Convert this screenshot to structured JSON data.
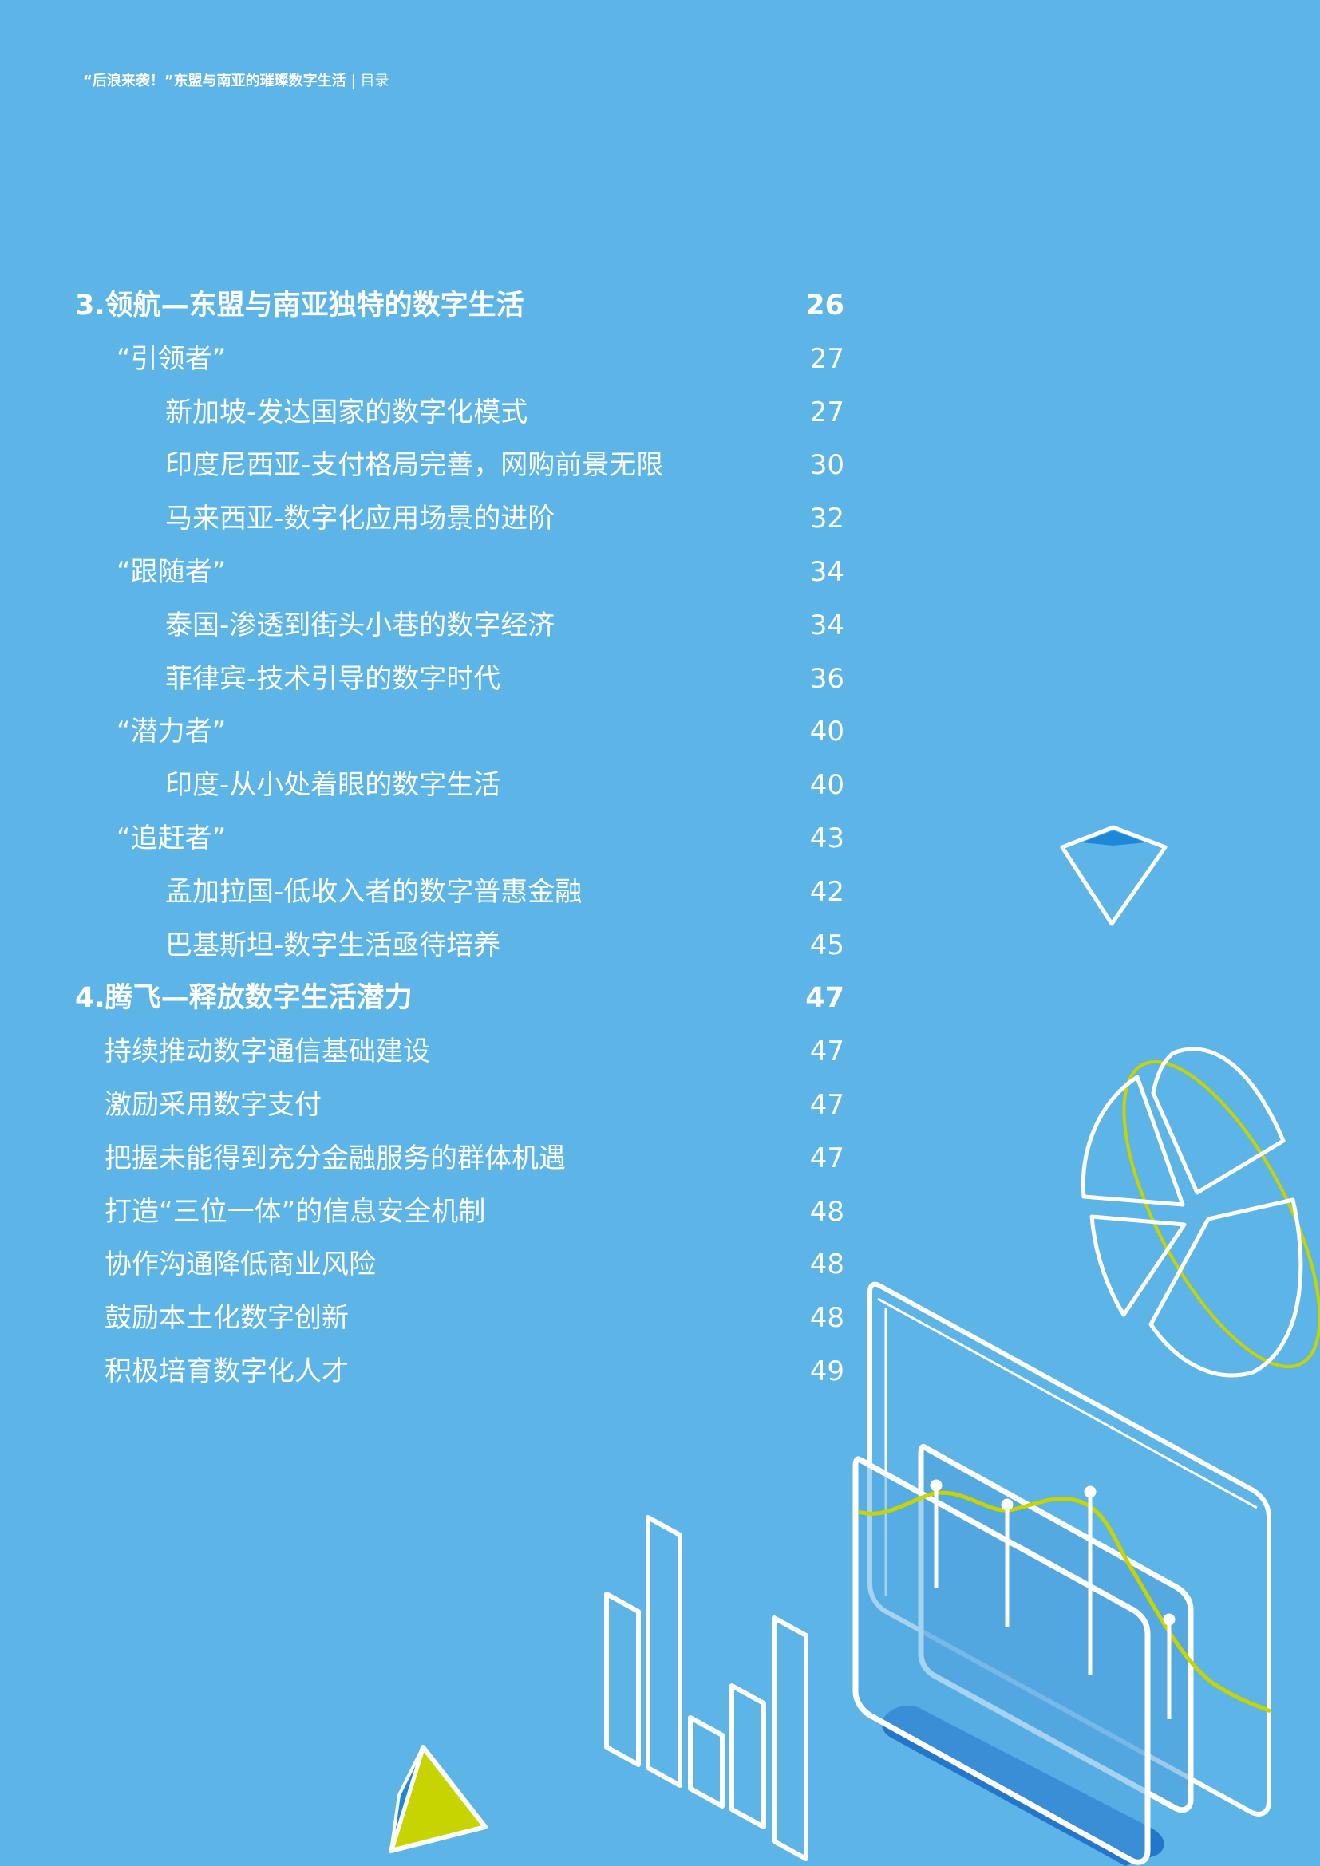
{
  "header": {
    "title": "“后浪来袭！”东盟与南亚的璀璨数字生活",
    "section": "| 目录"
  },
  "toc": [
    {
      "label": "3.领航—东盟与南亚独特的数字生活",
      "page": "26",
      "level": "section"
    },
    {
      "label": "“引领者”",
      "page": "27",
      "level": "group"
    },
    {
      "label": "新加坡-发达国家的数字化模式",
      "page": "27",
      "level": "item"
    },
    {
      "label": "印度尼西亚-支付格局完善，网购前景无限",
      "page": "30",
      "level": "item"
    },
    {
      "label": "马来西亚-数字化应用场景的进阶",
      "page": "32",
      "level": "item"
    },
    {
      "label": "“跟随者”",
      "page": "34",
      "level": "group"
    },
    {
      "label": "泰国-渗透到街头小巷的数字经济",
      "page": "34",
      "level": "item"
    },
    {
      "label": "菲律宾-技术引导的数字时代",
      "page": "36",
      "level": "item"
    },
    {
      "label": "“潜力者”",
      "page": "40",
      "level": "group"
    },
    {
      "label": "印度-从小处着眼的数字生活",
      "page": "40",
      "level": "item"
    },
    {
      "label": "“追赶者”",
      "page": "43",
      "level": "group"
    },
    {
      "label": "孟加拉国-低收入者的数字普惠金融",
      "page": "42",
      "level": "item"
    },
    {
      "label": "巴基斯坦-数字生活亟待培养",
      "page": "45",
      "level": "item"
    },
    {
      "label": "4.腾飞—释放数字生活潜力",
      "page": "47",
      "level": "section"
    },
    {
      "label": "持续推动数字通信基础建设",
      "page": "47",
      "level": "sub"
    },
    {
      "label": "激励采用数字支付",
      "page": "47",
      "level": "sub"
    },
    {
      "label": "把握未能得到充分金融服务的群体机遇",
      "page": "47",
      "level": "sub"
    },
    {
      "label": "打造“三位一体”的信息安全机制",
      "page": "48",
      "level": "sub"
    },
    {
      "label": "协作沟通降低商业风险",
      "page": "48",
      "level": "sub"
    },
    {
      "label": "鼓励本土化数字创新",
      "page": "48",
      "level": "sub"
    },
    {
      "label": "积极培育数字化人才",
      "page": "49",
      "level": "sub"
    }
  ],
  "colors": {
    "background": "#5db4e7",
    "text": "#ffffff",
    "accent_lime": "#c8d400",
    "accent_blue": "#1e88d8"
  }
}
